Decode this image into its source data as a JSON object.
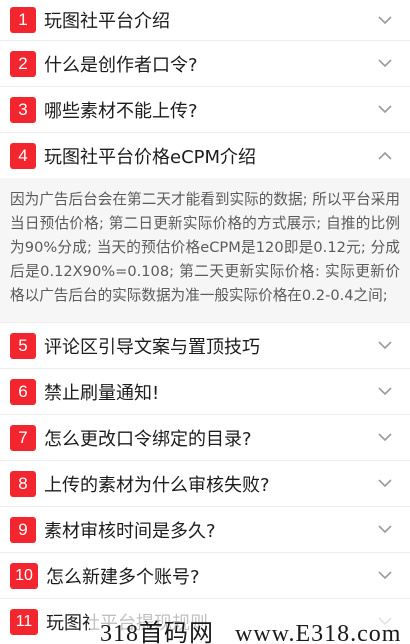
{
  "faq": {
    "items": [
      {
        "number": "1",
        "title": "玩图社平台介绍",
        "expanded": false
      },
      {
        "number": "2",
        "title": "什么是创作者口令?",
        "expanded": false
      },
      {
        "number": "3",
        "title": "哪些素材不能上传?",
        "expanded": false
      },
      {
        "number": "4",
        "title": "玩图社平台价格eCPM介绍",
        "expanded": true,
        "answer": "因为广告后台会在第二天才能看到实际的数据; 所以平台采用当日预估价格; 第二日更新实际价格的方式展示; 自推的比例为90%分成; 当天的预估价格eCPM是120即是0.12元; 分成后是0.12X90%=0.108; 第二天更新实际价格: 实际更新价格以广告后台的实际数据为准一般实际价格在0.2-0.4之间;"
      },
      {
        "number": "5",
        "title": "评论区引导文案与置顶技巧",
        "expanded": false
      },
      {
        "number": "6",
        "title": "禁止刷量通知!",
        "expanded": false
      },
      {
        "number": "7",
        "title": "怎么更改口令绑定的目录?",
        "expanded": false
      },
      {
        "number": "8",
        "title": "上传的素材为什么审核失败?",
        "expanded": false
      },
      {
        "number": "9",
        "title": "素材审核时间是多久?",
        "expanded": false
      },
      {
        "number": "10",
        "title": "怎么新建多个账号?",
        "expanded": false
      },
      {
        "number": "11",
        "title": "玩图社平台提现规则",
        "expanded": false
      }
    ]
  },
  "watermark": {
    "cn_text": "318首码网",
    "url_text": "www.E318.com"
  },
  "colors": {
    "badge": "#f3262f",
    "chevron": "#9a9a9a",
    "answer_bg": "#f6f6f6"
  },
  "icons": {
    "collapsed": "chevron-down-icon",
    "expanded": "chevron-up-icon"
  }
}
